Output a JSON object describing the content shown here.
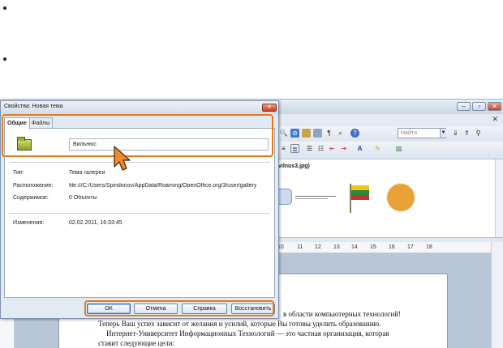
{
  "background_window": {
    "find_placeholder": "Найти",
    "gallery_title": "vilnus3.jpg)",
    "ruler_ticks": [
      "10",
      "11",
      "12",
      "13",
      "14",
      "15",
      "16",
      "17",
      "18"
    ],
    "document_lines": [
      "в области компьютерных технологий!",
      "Теперь Ваш успех зависит от желания и усилий, которые Вы готовы уделить образованию.",
      "Интернет-Университет Информационных Технологий — это частная организация, которая",
      "ставит следующие цели:"
    ]
  },
  "dialog": {
    "title": "Свойства: Новая тема",
    "close_label": "✕",
    "tabs": [
      {
        "label": "Общие",
        "active": true
      },
      {
        "label": "Файлы",
        "active": false
      }
    ],
    "name_value": "Вильнюс",
    "properties": [
      {
        "label": "Тип:",
        "value": "Тема галереи"
      },
      {
        "label": "Расположение:",
        "value": "file:///C:/Users/Spiridonov/AppData/Roaming/OpenOffice.org/3/user/gallery"
      },
      {
        "label": "Содержимое:",
        "value": "0 Объекты"
      },
      {
        "label": "Изменения:",
        "value": "02.02.2011, 16:33:45"
      }
    ],
    "buttons": {
      "ok": "ОК",
      "cancel": "Отмена",
      "help": "Справка",
      "restore": "Восстановить"
    }
  },
  "colors": {
    "highlight": "#e07b1f",
    "dialog_bg": "#e2eaf4"
  }
}
